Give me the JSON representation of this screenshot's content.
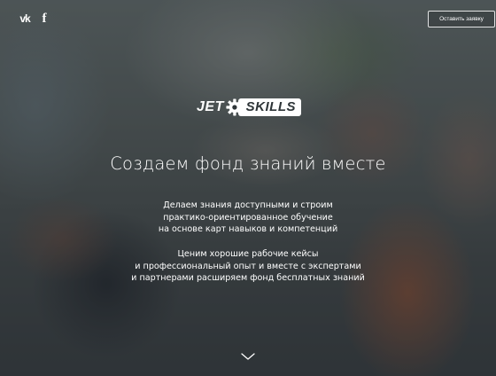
{
  "header": {
    "social": [
      {
        "name": "vk",
        "label": "vk"
      },
      {
        "name": "facebook",
        "label": "f"
      }
    ],
    "cta_label": "Оставить заявку"
  },
  "logo": {
    "part1": "JET",
    "part2": "SKILLS"
  },
  "hero": {
    "headline": "Создаем фонд знаний вместе",
    "paragraph1": [
      "Делаем знания доступными и строим",
      "практико-ориентированное обучение",
      "на основе карт навыков и компетенций"
    ],
    "paragraph2": [
      "Ценим хорошие рабочие кейсы",
      "и профессиональный опыт и вместе с экспертами",
      "и партнерами расширяем фонд бесплатных знаний"
    ]
  },
  "icons": {
    "scroll": "chevron-down-icon",
    "gear": "gear-icon"
  },
  "colors": {
    "text": "#ffffff",
    "overlay": "#14181c"
  }
}
